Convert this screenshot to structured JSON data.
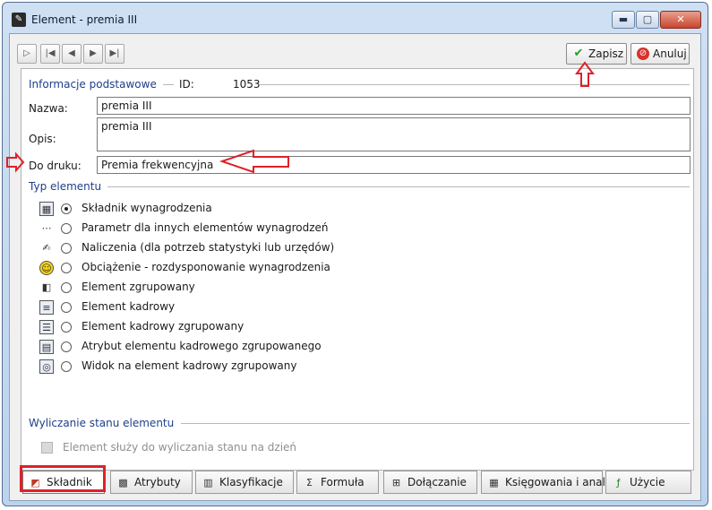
{
  "window": {
    "title": "Element - premia III",
    "buttons": {
      "minimize": "▬",
      "maximize": "▢",
      "close": "✕"
    }
  },
  "toolbar": {
    "nav": [
      {
        "name": "record-add-button",
        "icon": "▷"
      },
      {
        "name": "first-record-button",
        "icon": "|◀"
      },
      {
        "name": "prev-record-button",
        "icon": "◀"
      },
      {
        "name": "next-record-button",
        "icon": "▶"
      },
      {
        "name": "last-record-button",
        "icon": "▶|"
      }
    ],
    "save_label": "Zapisz",
    "cancel_label": "Anuluj"
  },
  "info": {
    "section_title": "Informacje podstawowe",
    "id_label": "ID:",
    "id_value": "1053",
    "name_label": "Nazwa:",
    "name_value": "premia III",
    "desc_label": "Opis:",
    "desc_value": "premia III",
    "print_label": "Do druku:",
    "print_value": "Premia frekwencyjna"
  },
  "type": {
    "section_title": "Typ elementu",
    "options": [
      {
        "label": "Składnik wynagrodzenia",
        "selected": true,
        "icon": "payroll-component-icon"
      },
      {
        "label": "Parametr dla innych elementów wynagrodzeń",
        "selected": false,
        "icon": "parameter-icon"
      },
      {
        "label": "Naliczenia (dla potrzeb statystyki lub urzędów)",
        "selected": false,
        "icon": "calculation-icon"
      },
      {
        "label": "Obciążenie - rozdysponowanie wynagrodzenia",
        "selected": false,
        "icon": "charge-icon"
      },
      {
        "label": "Element zgrupowany",
        "selected": false,
        "icon": "grouped-element-icon"
      },
      {
        "label": "Element kadrowy",
        "selected": false,
        "icon": "hr-element-icon"
      },
      {
        "label": "Element kadrowy zgrupowany",
        "selected": false,
        "icon": "hr-grouped-icon"
      },
      {
        "label": "Atrybut elementu kadrowego zgrupowanego",
        "selected": false,
        "icon": "hr-attribute-icon"
      },
      {
        "label": "Widok na element kadrowy zgrupowany",
        "selected": false,
        "icon": "hr-view-icon"
      }
    ]
  },
  "state": {
    "section_title": "Wyliczanie stanu elementu",
    "checkbox_label": "Element służy do wyliczania stanu na dzień"
  },
  "tabs": [
    {
      "label": "Składnik",
      "active": true
    },
    {
      "label": "Atrybuty",
      "active": false
    },
    {
      "label": "Klasyfikacje",
      "active": false
    },
    {
      "label": "Formuła",
      "active": false
    },
    {
      "label": "Dołączanie",
      "active": false
    },
    {
      "label": "Księgowania i analizy",
      "active": false
    },
    {
      "label": "Użycie",
      "active": false
    }
  ],
  "colors": {
    "section_title": "#1d3f8a",
    "annotation": "#e0202a",
    "save_check": "#2a9a2a"
  }
}
